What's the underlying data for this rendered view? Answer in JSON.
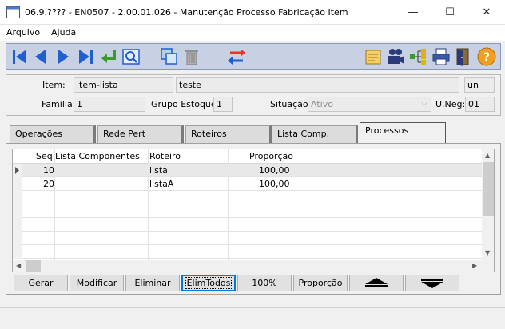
{
  "window": {
    "title": "06.9.???? - EN0507 - 2.00.01.026 - Manutenção Processo Fabricação Item"
  },
  "menu": [
    "Arquivo",
    "Ajuda"
  ],
  "toolbar": {
    "nav_icons": [
      "first-record-icon",
      "previous-record-icon",
      "next-record-icon",
      "last-record-icon",
      "goto-record-icon",
      "search-zoom-icon"
    ],
    "edit_icons": [
      "copy-icon",
      "delete-icon",
      "exchange-icon"
    ],
    "right_icons": [
      "report-icon",
      "camera-icon",
      "hierarchy-icon",
      "print-icon",
      "exit-icon",
      "help-icon"
    ]
  },
  "fields": {
    "item_label": "Item:",
    "item_code": "item-lista",
    "item_desc": "teste",
    "item_unit": "un",
    "familia_label": "Família:",
    "familia_value": "1",
    "grupo_label": "Grupo Estoque:",
    "grupo_value": "1",
    "situacao_label": "Situação:",
    "situacao_value": "Ativo",
    "uneg_label": "U.Neg:",
    "uneg_value": "01"
  },
  "tabs": [
    {
      "label": "Operações"
    },
    {
      "label": "Rede Pert"
    },
    {
      "label": "Roteiros"
    },
    {
      "label": "Lista Comp."
    },
    {
      "label": "Processos",
      "active": true
    }
  ],
  "grid": {
    "columns": [
      "Seq",
      "Lista Componentes",
      "Roteiro",
      "Proporção"
    ],
    "rows": [
      {
        "seq": "10",
        "lista": "",
        "roteiro": "lista",
        "proporcao": "100,00"
      },
      {
        "seq": "20",
        "lista": "",
        "roteiro": "listaA",
        "proporcao": "100,00"
      }
    ]
  },
  "actions": {
    "gerar": "Gerar",
    "modificar": "Modificar",
    "eliminar": "Eliminar",
    "elim_todos": "ElimTodos",
    "cem": "100%",
    "proporcao": "Proporção"
  }
}
